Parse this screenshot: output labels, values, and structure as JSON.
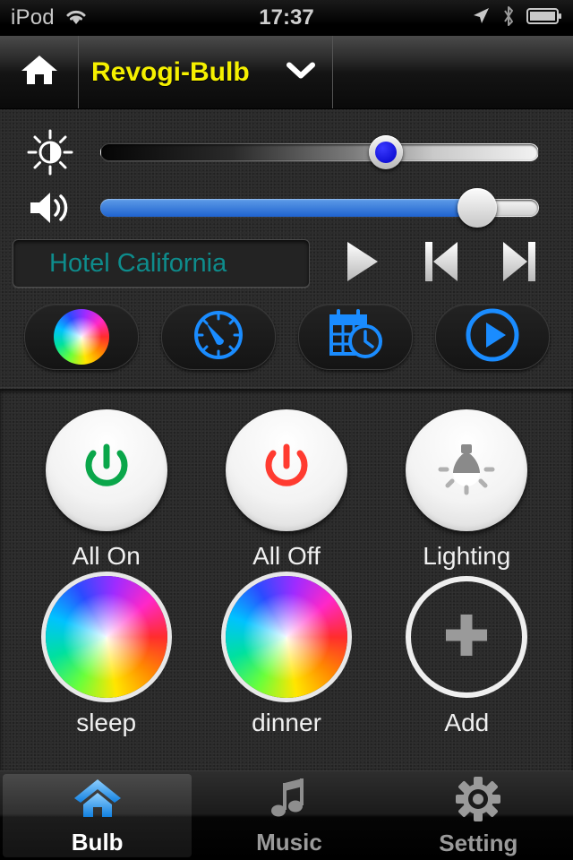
{
  "statusbar": {
    "carrier": "iPod",
    "time": "17:37",
    "icons": [
      "wifi-icon",
      "location-arrow-icon",
      "bluetooth-icon",
      "battery-icon"
    ]
  },
  "navbar": {
    "home_icon": "home-icon",
    "device_name": "Revogi-Bulb",
    "caret_icon": "chevron-down-icon",
    "title_color": "#f5f000"
  },
  "controls": {
    "brightness": {
      "icon": "brightness-icon",
      "value_percent": 65,
      "thumb_color": "#1212d8"
    },
    "volume": {
      "icon": "volume-icon",
      "value_percent": 86,
      "fill_color": "#1f63cf"
    },
    "media": {
      "track_title": "Hotel California",
      "track_title_color": "#0e8c8c",
      "buttons": [
        {
          "name": "play-button",
          "icon": "play-icon"
        },
        {
          "name": "previous-button",
          "icon": "previous-track-icon"
        },
        {
          "name": "next-button",
          "icon": "next-track-icon"
        }
      ]
    },
    "quick_actions": [
      {
        "name": "color-wheel-button",
        "icon": "color-wheel-icon"
      },
      {
        "name": "timer-button",
        "icon": "timer-dial-icon"
      },
      {
        "name": "schedule-button",
        "icon": "calendar-clock-icon"
      },
      {
        "name": "play-mode-button",
        "icon": "play-circle-icon"
      }
    ],
    "accent_blue": "#1a8cff"
  },
  "scenes": [
    {
      "name": "all-on",
      "label": "All On",
      "icon": "power-icon",
      "icon_color": "#0aa64a",
      "style": "white-circle"
    },
    {
      "name": "all-off",
      "label": "All Off",
      "icon": "power-icon",
      "icon_color": "#ff3b30",
      "style": "white-circle"
    },
    {
      "name": "lighting",
      "label": "Lighting",
      "icon": "light-bulb-icon",
      "icon_color": "#8a8a8a",
      "style": "white-circle"
    },
    {
      "name": "sleep",
      "label": "sleep",
      "icon": "color-wheel-icon",
      "icon_color": "",
      "style": "color-wheel"
    },
    {
      "name": "dinner",
      "label": "dinner",
      "icon": "color-wheel-icon",
      "icon_color": "",
      "style": "color-wheel"
    },
    {
      "name": "add",
      "label": "Add",
      "icon": "plus-icon",
      "icon_color": "#9a9a9a",
      "style": "outline-circle"
    }
  ],
  "tabbar": {
    "tabs": [
      {
        "name": "tab-bulb",
        "label": "Bulb",
        "icon": "home-icon",
        "active": true
      },
      {
        "name": "tab-music",
        "label": "Music",
        "icon": "music-note-icon",
        "active": false
      },
      {
        "name": "tab-setting",
        "label": "Setting",
        "icon": "gear-icon",
        "active": false
      }
    ],
    "active_icon_color": "#2196f3"
  }
}
